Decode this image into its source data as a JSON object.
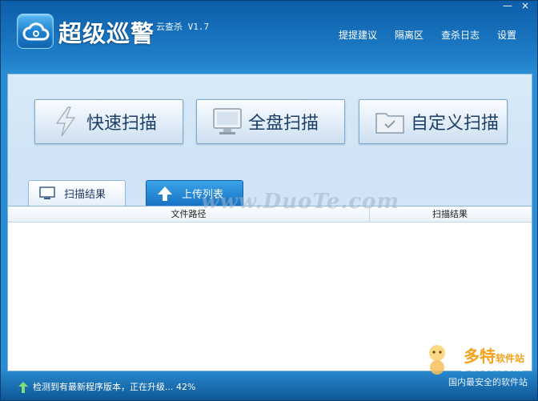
{
  "app": {
    "title": "超级巡警",
    "subtitle": "云查杀 V1.7"
  },
  "window_controls": {
    "minimize": "—",
    "close": "×"
  },
  "nav": [
    {
      "label": "提提建议"
    },
    {
      "label": "隔离区"
    },
    {
      "label": "查杀日志"
    },
    {
      "label": "设置"
    }
  ],
  "scan_buttons": [
    {
      "label": "快速扫描",
      "icon": "lightning-icon"
    },
    {
      "label": "全盘扫描",
      "icon": "monitor-icon"
    },
    {
      "label": "自定义扫描",
      "icon": "folder-icon"
    }
  ],
  "tabs": [
    {
      "label": "扫描结果",
      "icon": "monitor-icon",
      "active": false
    },
    {
      "label": "上传列表",
      "icon": "upload-arrow-icon",
      "active": true
    }
  ],
  "table": {
    "columns": [
      "文件路径",
      "扫描结果"
    ],
    "rows": []
  },
  "watermark": "www.DuoTe.com",
  "status": {
    "text": "检测到有最新程序版本，正在升级... 42%",
    "progress_percent": 42
  },
  "brand": {
    "name": "多特",
    "suffix": "软件站",
    "url": "DuoTe.Com",
    "slogan": "国内最安全的软件站"
  },
  "colors": {
    "accent": "#1e7dc8",
    "title_text": "#ffffff",
    "button_text": "#1d3f66",
    "brand_orange": "#f4a21a"
  }
}
